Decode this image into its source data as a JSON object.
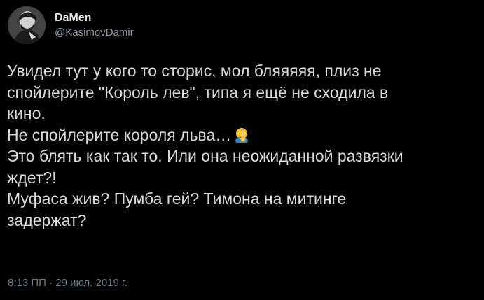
{
  "author": {
    "display_name": "DaMen",
    "handle": "@KasimovDamir"
  },
  "tweet": {
    "lines": [
      "Увидел тут у кого то сторис, мол бляяяяя, плиз не",
      "спойлерите \"Король лев\", типа я ещё не сходила в",
      "кино.",
      "Не спойлерите короля льва…",
      "Это блять как так то. Или она неожиданной развязки",
      "ждет?!",
      "Муфаса жив? Пумба гей? Тимона на митинге",
      "задержат?"
    ],
    "emoji": "facepalm-emoji",
    "timestamp": "8:13 ПП · 29 июл. 2019 г."
  },
  "colors": {
    "background": "#000000",
    "text": "#d9d9d9",
    "name": "#e6e6e6",
    "handle": "#8b98a5",
    "meta": "#6e7b87",
    "emoji_skin": "#f5c542"
  }
}
